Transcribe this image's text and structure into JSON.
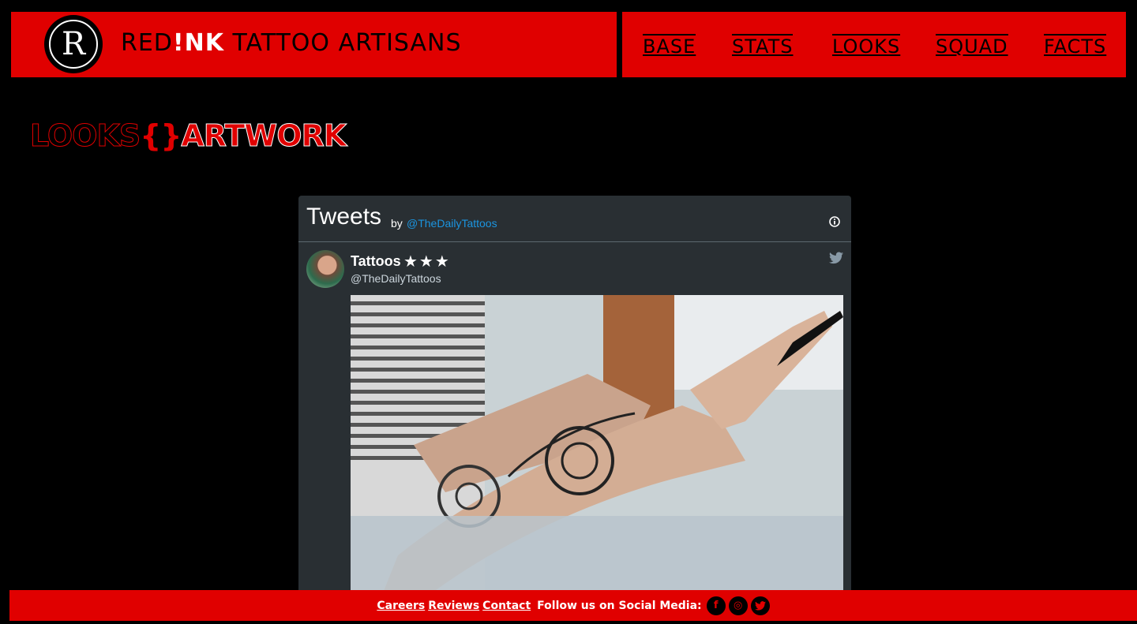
{
  "header": {
    "brand_part1": "RED",
    "brand_part2": "!NK",
    "brand_part3": " TATTOO ARTISANS",
    "logo_letter": "R"
  },
  "nav": {
    "items": [
      {
        "label": "BASE"
      },
      {
        "label": "STATS"
      },
      {
        "label": "LOOKS"
      },
      {
        "label": "SQUAD"
      },
      {
        "label": "FACTS"
      }
    ]
  },
  "page_title": {
    "part1": "LOOKS",
    "brace": "{}",
    "part2": "ARTWORK"
  },
  "widget": {
    "title": "Tweets",
    "by": "by",
    "handle": "@TheDailyTattoos",
    "tweet": {
      "author_name": "Tattoos",
      "author_stars": "★★★",
      "author_handle": "@TheDailyTattoos"
    }
  },
  "footer": {
    "links": [
      "Careers",
      "Reviews",
      "Contact"
    ],
    "follow_text": "Follow us on Social Media:",
    "social": [
      "facebook-icon",
      "instagram-icon",
      "twitter-icon"
    ]
  },
  "colors": {
    "accent": "#e00000",
    "background": "#000000",
    "widget_bg": "#292f33",
    "link_blue": "#1b95e0"
  }
}
